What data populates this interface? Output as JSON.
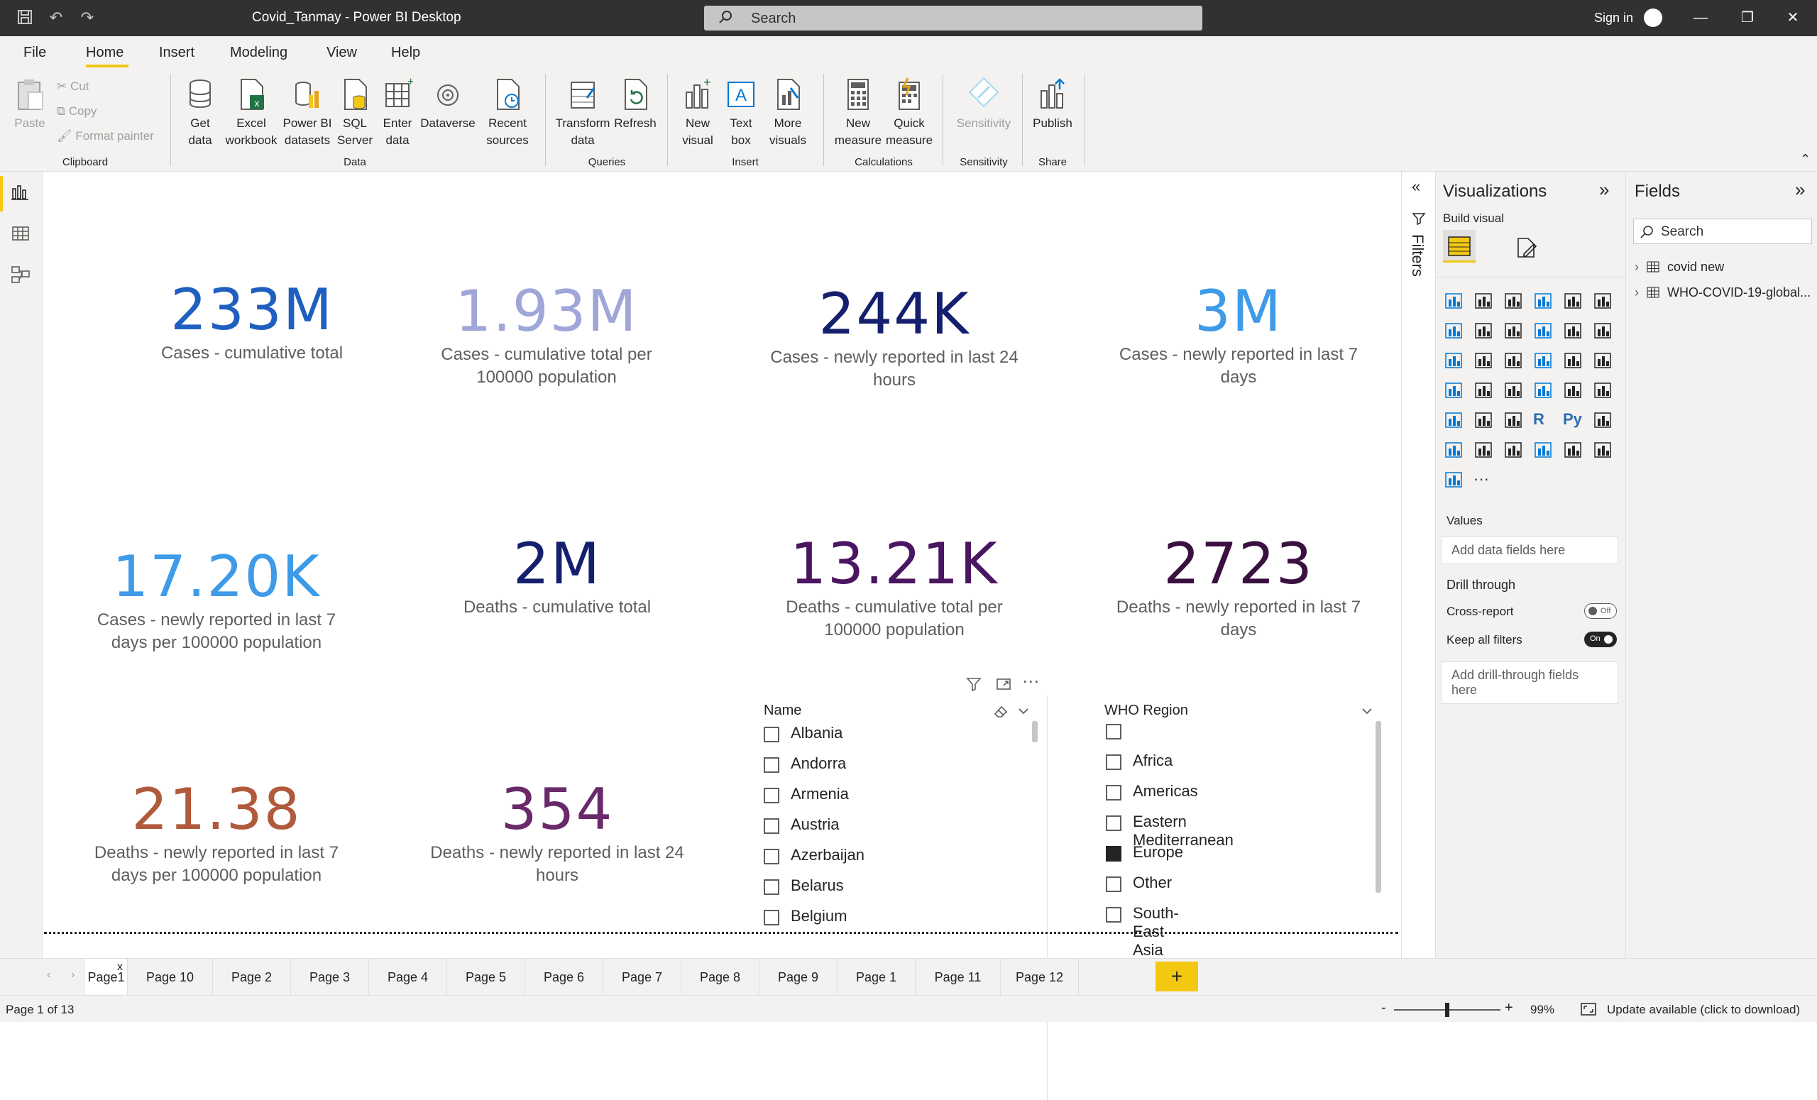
{
  "titlebar": {
    "title": "Covid_Tanmay - Power BI Desktop",
    "search_placeholder": "Search",
    "signin": "Sign in"
  },
  "menu": {
    "items": [
      "File",
      "Home",
      "Insert",
      "Modeling",
      "View",
      "Help"
    ],
    "active": "Home"
  },
  "ribbon": {
    "clipboard": {
      "paste": "Paste",
      "cut": "Cut",
      "copy": "Copy",
      "format_painter": "Format painter",
      "group": "Clipboard"
    },
    "data": {
      "get_data": "Get data",
      "excel": "Excel workbook",
      "pbi_datasets": "Power BI datasets",
      "sql": "SQL Server",
      "enter_data": "Enter data",
      "dataverse": "Dataverse",
      "recent": "Recent sources",
      "group": "Data"
    },
    "queries": {
      "transform": "Transform data",
      "refresh": "Refresh",
      "group": "Queries"
    },
    "insert": {
      "new_visual": "New visual",
      "text_box": "Text box",
      "more_visuals": "More visuals",
      "group": "Insert"
    },
    "calculations": {
      "new_measure": "New measure",
      "quick_measure": "Quick measure",
      "group": "Calculations"
    },
    "sensitivity": {
      "sensitivity": "Sensitivity",
      "group": "Sensitivity"
    },
    "share": {
      "publish": "Publish",
      "group": "Share"
    }
  },
  "cards": [
    {
      "value": "233M",
      "label": "Cases - cumulative total",
      "color": "#1f5fbf"
    },
    {
      "value": "1.93M",
      "label": "Cases - cumulative total per 100000 population",
      "color": "#9fa6d8"
    },
    {
      "value": "244K",
      "label": "Cases - newly reported in last 24 hours",
      "color": "#14206e"
    },
    {
      "value": "3M",
      "label": "Cases - newly reported in last 7 days",
      "color": "#3f9be8"
    },
    {
      "value": "17.20K",
      "label": "Cases - newly reported in last 7 days per 100000 population",
      "color": "#3f9be8"
    },
    {
      "value": "2M",
      "label": "Deaths - cumulative total",
      "color": "#14206e"
    },
    {
      "value": "13.21K",
      "label": "Deaths - cumulative total per 100000 population",
      "color": "#4a1561"
    },
    {
      "value": "2723",
      "label": "Deaths - newly reported in last 7 days",
      "color": "#3a1040"
    },
    {
      "value": "21.38",
      "label": "Deaths - newly reported in last 7 days per 100000 population",
      "color": "#b05a3c"
    },
    {
      "value": "354",
      "label": "Deaths - newly reported in last 24 hours",
      "color": "#6a2a6a"
    }
  ],
  "slicer_name": {
    "header": "Name",
    "items": [
      "Albania",
      "Andorra",
      "Armenia",
      "Austria",
      "Azerbaijan",
      "Belarus",
      "Belgium"
    ]
  },
  "slicer_region": {
    "header": "WHO Region",
    "items": [
      {
        "label": "",
        "checked": false
      },
      {
        "label": "Africa",
        "checked": false
      },
      {
        "label": "Americas",
        "checked": false
      },
      {
        "label": "Eastern Mediterranean",
        "checked": false
      },
      {
        "label": "Europe",
        "checked": true
      },
      {
        "label": "Other",
        "checked": false
      },
      {
        "label": "South-East Asia",
        "checked": false
      }
    ]
  },
  "filters": {
    "label": "Filters"
  },
  "visualizations": {
    "title": "Visualizations",
    "build_visual": "Build visual",
    "values_label": "Values",
    "values_well": "Add data fields here",
    "drill_through": "Drill through",
    "cross_report": "Cross-report",
    "cross_report_state": "Off",
    "keep_all_filters": "Keep all filters",
    "keep_all_filters_state": "On",
    "drill_well": "Add drill-through fields here",
    "r_label": "R",
    "py_label": "Py",
    "more": "···"
  },
  "fields": {
    "title": "Fields",
    "search_placeholder": "Search",
    "tables": [
      "covid new",
      "WHO-COVID-19-global..."
    ]
  },
  "pages": {
    "tabs": [
      "Page1",
      "Page 10",
      "Page 2",
      "Page 3",
      "Page 4",
      "Page 5",
      "Page 6",
      "Page 7",
      "Page 8",
      "Page 9",
      "Page 1",
      "Page 11",
      "Page 12"
    ],
    "active": "Page1",
    "add": "+",
    "close": "x"
  },
  "status": {
    "page_info": "Page 1 of 13",
    "zoom": "99%",
    "zoom_level": 0.5,
    "update": "Update available (click to download)",
    "minus": "-",
    "plus": "+"
  }
}
